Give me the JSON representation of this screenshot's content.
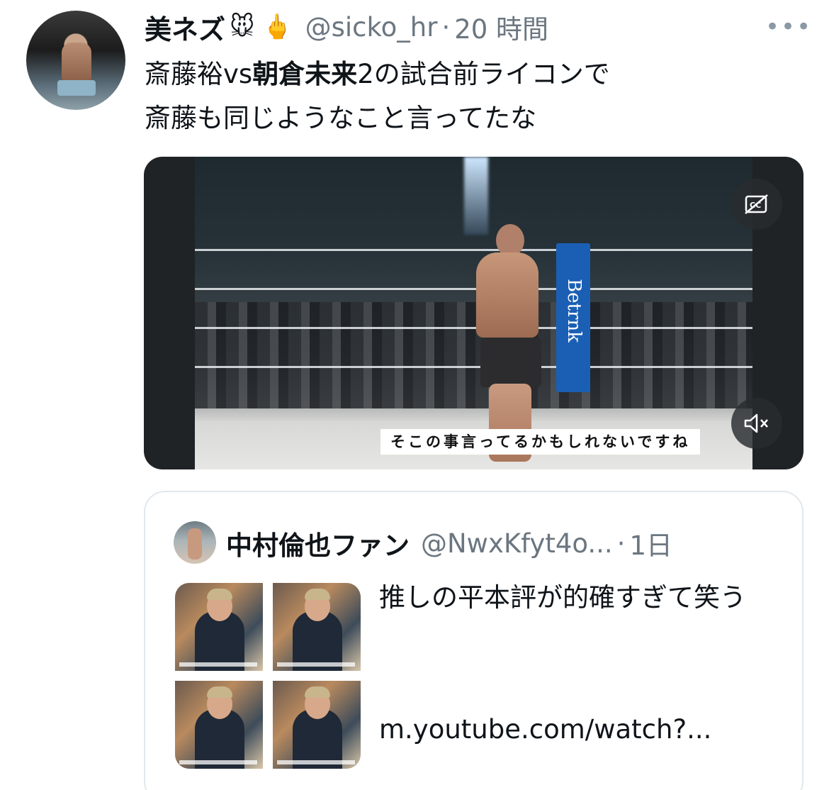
{
  "tweet": {
    "author_name": "美ネズ",
    "author_emoji": "🐭 🖕",
    "handle": "@sicko_hr",
    "separator": "·",
    "time": "20 時間",
    "more": "•••",
    "text_line1_part1": "斎藤裕vs",
    "text_line1_bold": "朝倉未来",
    "text_line1_part2": "2の試合前ライコンで",
    "text_line2": "斎藤も同じようなこと言ってたな"
  },
  "video": {
    "subtitle": "そこの事言ってるかもしれないですね",
    "banner_text": "Betrnk",
    "cc_icon": "captions-off-icon",
    "mute_icon": "speaker-muted-icon"
  },
  "quote": {
    "author_name": "中村倫也ファン",
    "handle": "@NwxKfyt4o...",
    "separator": "·",
    "time": "1日",
    "text": "推しの平本評が的確すぎて笑う",
    "link": "m.youtube.com/watch?..."
  }
}
